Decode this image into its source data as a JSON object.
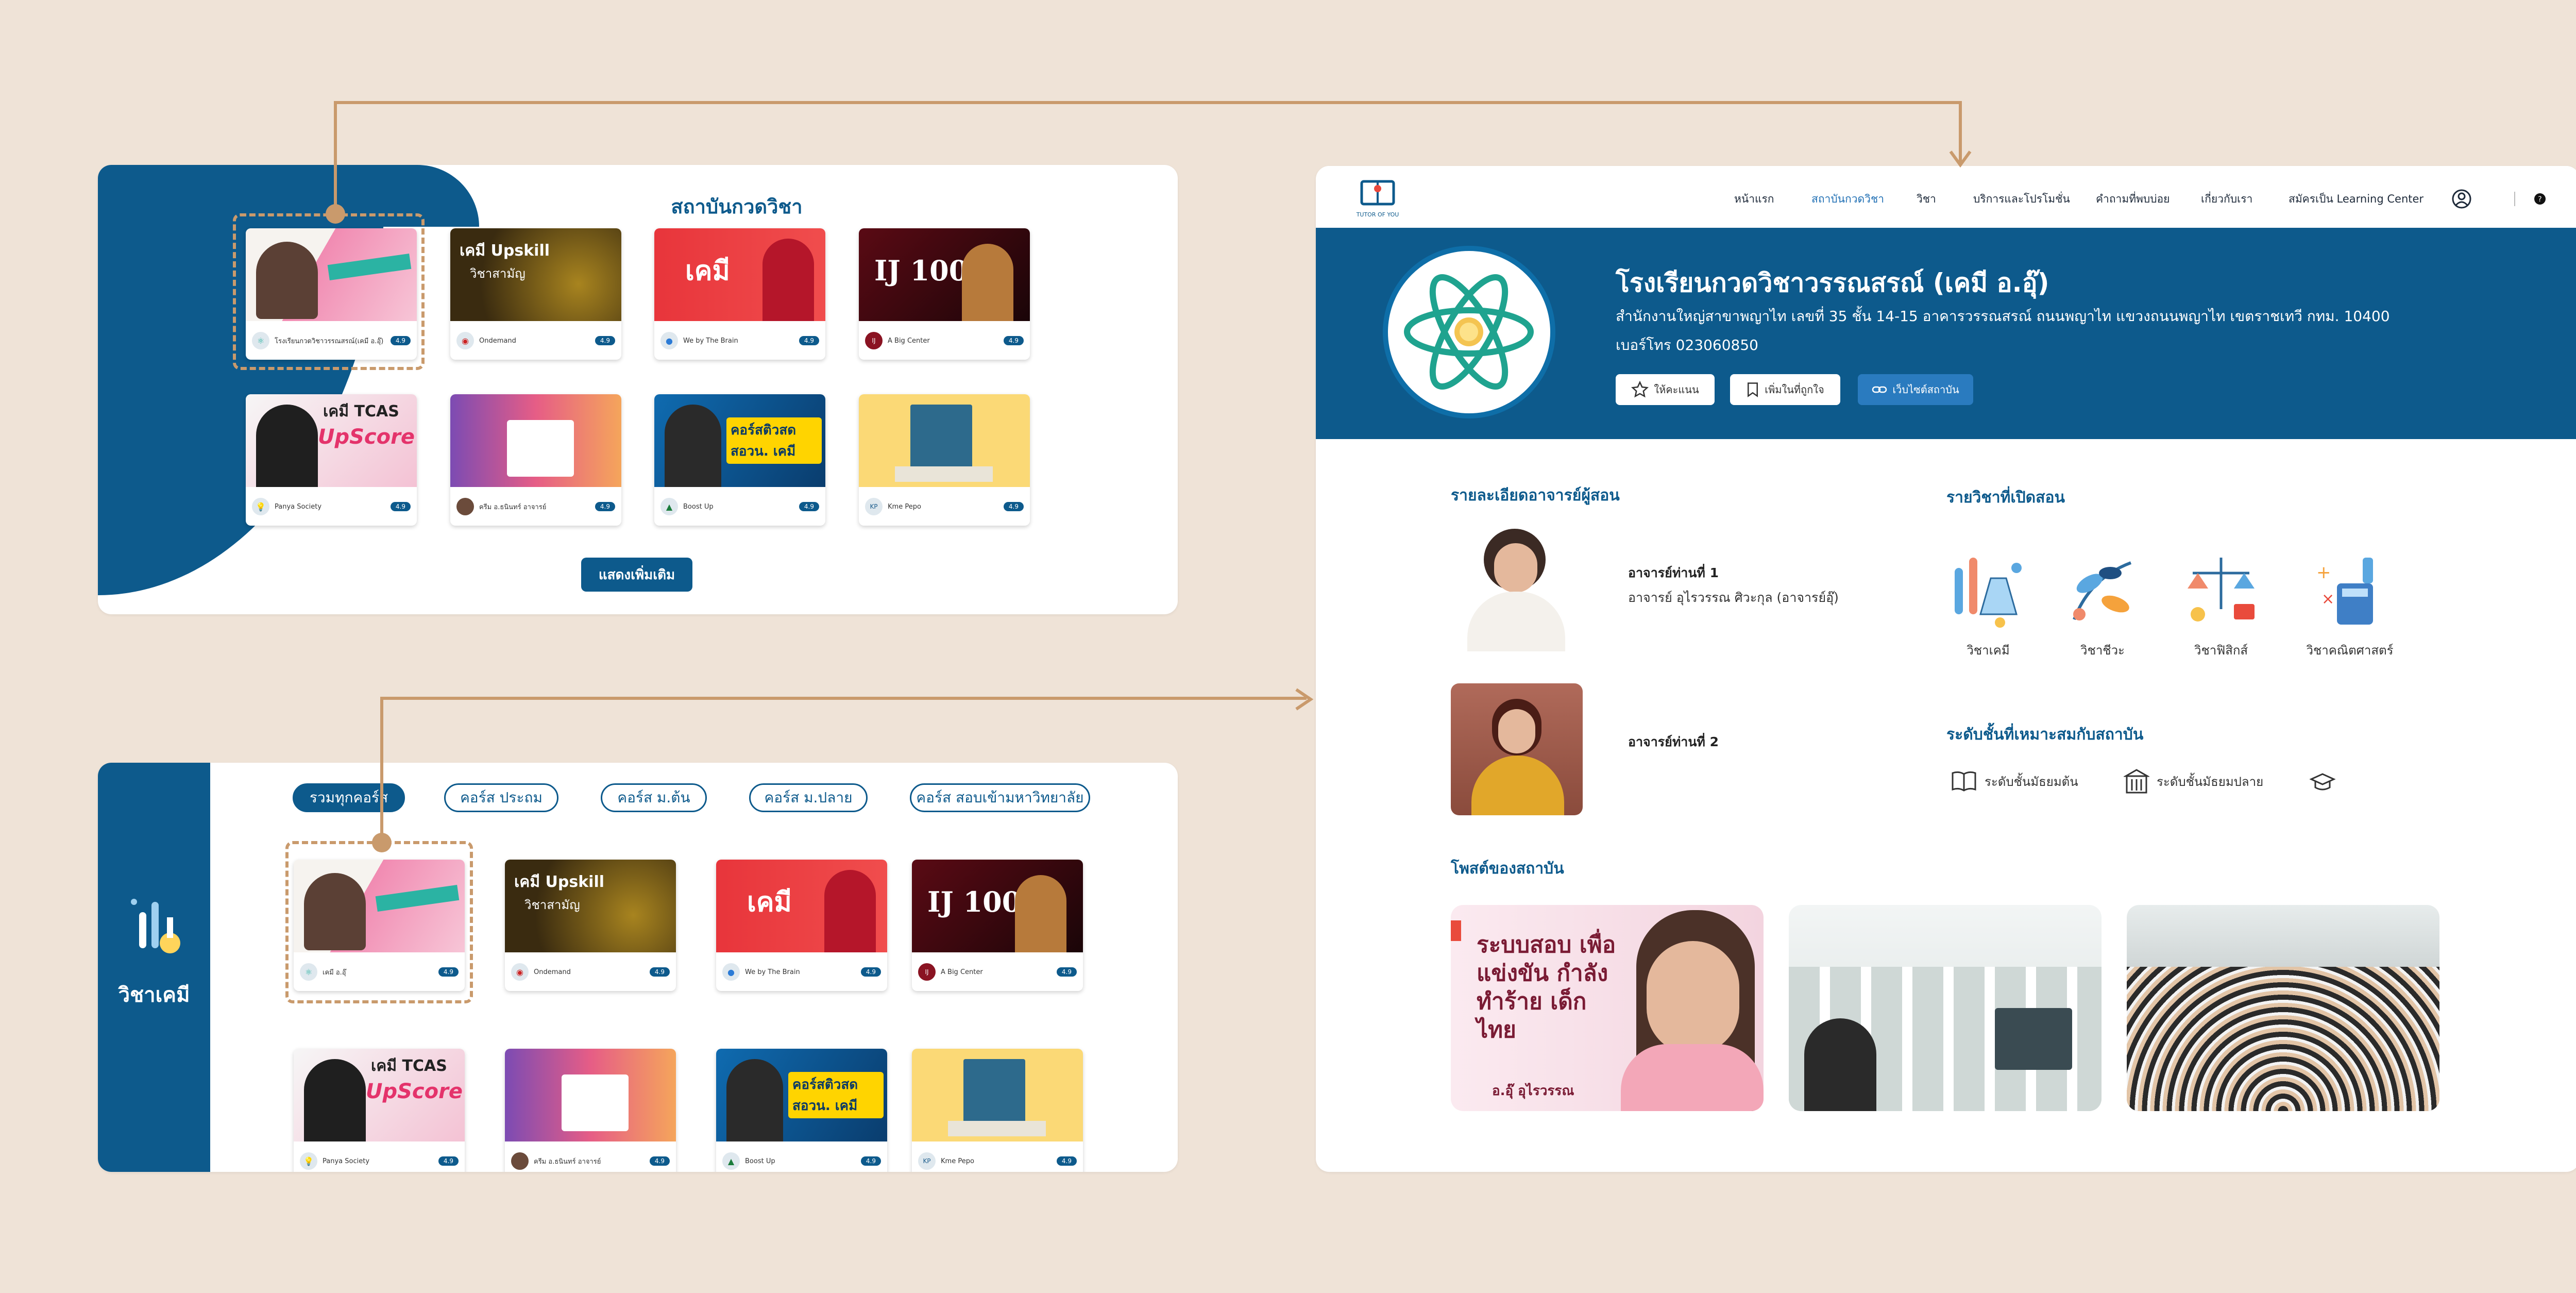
{
  "colors": {
    "background": "#efe3d7",
    "brand": "#0d5a8c",
    "accent": "#c99a6c",
    "link": "#1f6fb4"
  },
  "panel1": {
    "title": "สถาบันกวดวิชา",
    "show_more": "แสดงเพิ่มเติม",
    "cards": [
      {
        "thumb_title": "",
        "institute": "โรงเรียนกวดวิชาวรรณสรณ์(เคมี อ.อุ๊)",
        "rating": "4.9"
      },
      {
        "thumb_title": "เคมี Upskill",
        "thumb_sub": "วิชาสามัญ",
        "institute": "Ondemand",
        "rating": "4.9"
      },
      {
        "thumb_title": "เคมี",
        "institute": "We by The Brain",
        "rating": "4.9"
      },
      {
        "thumb_title": "IJ 100",
        "institute": "A Big Center",
        "rating": "4.9"
      },
      {
        "thumb_title": "เคมี TCAS",
        "thumb_sub": "UpScore",
        "institute": "Panya Society",
        "rating": "4.9"
      },
      {
        "thumb_title": "",
        "institute": "ครีม อ.ธนินทร์ อาจารย์",
        "rating": "4.9"
      },
      {
        "thumb_title": "คอร์สติวสด สอวน. เคมี",
        "institute": "Boost Up",
        "rating": "4.9"
      },
      {
        "thumb_title": "",
        "institute": "Kme Pepo",
        "rating": "4.9"
      }
    ]
  },
  "panel2": {
    "side_label": "วิชาเคมี",
    "tabs": [
      "รวมทุกคอร์ส",
      "คอร์ส ประถม",
      "คอร์ส ม.ต้น",
      "คอร์ส ม.ปลาย",
      "คอร์ส สอบเข้ามหาวิทยาลัย"
    ],
    "cards": [
      {
        "thumb_title": "",
        "institute": "เคมี อ.อุ๊",
        "rating": "4.9"
      },
      {
        "thumb_title": "เคมี Upskill",
        "thumb_sub": "วิชาสามัญ",
        "institute": "Ondemand",
        "rating": "4.9"
      },
      {
        "thumb_title": "เคมี",
        "institute": "We by The Brain",
        "rating": "4.9"
      },
      {
        "thumb_title": "IJ 100",
        "institute": "A Big Center",
        "rating": "4.9"
      },
      {
        "thumb_title": "เคมี TCAS",
        "thumb_sub": "UpScore",
        "institute": "Panya Society",
        "rating": "4.9"
      },
      {
        "thumb_title": "",
        "institute": "ครีม อ.ธนินทร์ อาจารย์",
        "rating": "4.9"
      },
      {
        "thumb_title": "คอร์สติวสด สอวน. เคมี",
        "institute": "Boost Up",
        "rating": "4.9"
      },
      {
        "thumb_title": "",
        "institute": "Kme Pepo",
        "rating": "4.9"
      }
    ]
  },
  "panel3": {
    "logo_text": "TUTOR OF YOU",
    "nav": [
      "หน้าแรก",
      "สถาบันกวดวิชา",
      "วิชา",
      "บริการและโปรโมชั่น",
      "คำถามที่พบบ่อย",
      "เกี่ยวกับเรา",
      "สมัครเป็น Learning Center"
    ],
    "school_name": "โรงเรียนกวดวิชาวรรณสรณ์ (เคมี อ.อุ๊)",
    "address": "สำนักงานใหญ่สาขาพญาไท เลขที่ 35 ชั้น 14-15 อาคารวรรณสรณ์ ถนนพญาไท แขวงถนนพญาไท เขตราชเทวี กทม. 10400",
    "phone": "เบอร์โทร 023060850",
    "buttons": {
      "review": "ให้คะแนน",
      "bookmark": "เพิ่มในที่ถูกใจ",
      "website": "เว็บไซต์สถาบัน"
    },
    "teachers_title": "รายละเอียดอาจารย์ผู้สอน",
    "teachers": [
      {
        "label": "อาจารย์ท่านที่ 1",
        "name": "อาจารย์ อุไรวรรณ ศิวะกุล (อาจารย์อุ๊)"
      },
      {
        "label": "อาจารย์ท่านที่ 2",
        "name": ""
      }
    ],
    "subjects_title": "รายวิชาที่เปิดสอน",
    "subjects": [
      "วิชาเคมี",
      "วิชาชีวะ",
      "วิชาฟิสิกส์",
      "วิชาคณิตศาสตร์"
    ],
    "levels_title": "ระดับชั้นที่เหมาะสมกับสถาบัน",
    "levels": [
      "ระดับชั้นมัธยมต้น",
      "ระดับชั้นมัธยมปลาย"
    ],
    "posts_title": "โพสต์ของสถาบัน",
    "post1_text": "ระบบสอบ เพื่อแข่งขัน กำลังทำร้าย เด็กไทย",
    "post1_caption": "อ.อุ๊ อุไรวรรณ"
  }
}
